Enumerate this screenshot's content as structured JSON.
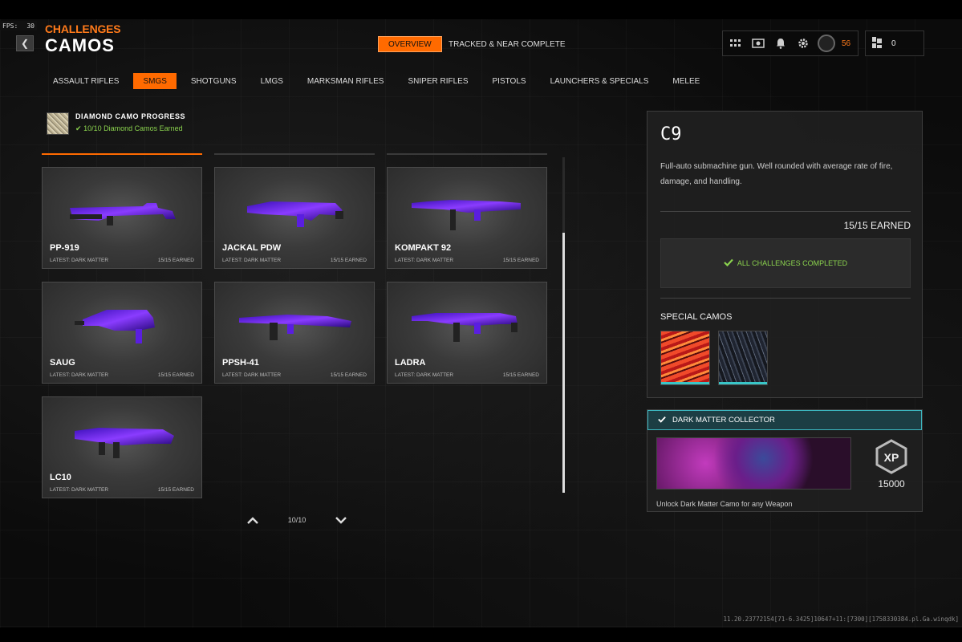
{
  "hud": {
    "fps_label": "FPS:",
    "fps_value": "30",
    "level": "56",
    "currency": "0"
  },
  "header": {
    "breadcrumb": "CHALLENGES",
    "title": "CAMOS",
    "tab_overview": "OVERVIEW",
    "tab_tracked": "TRACKED & NEAR COMPLETE"
  },
  "categories": [
    "ASSAULT RIFLES",
    "SMGS",
    "SHOTGUNS",
    "LMGS",
    "MARKSMAN RIFLES",
    "SNIPER RIFLES",
    "PISTOLS",
    "LAUNCHERS & SPECIALS",
    "MELEE"
  ],
  "active_category": "SMGS",
  "progress": {
    "title": "DIAMOND CAMO PROGRESS",
    "status": "10/10 Diamond Camos Earned"
  },
  "weapons": [
    {
      "name": "PP-919",
      "latest": "LATEST: DARK MATTER",
      "earned": "15/15 EARNED"
    },
    {
      "name": "JACKAL PDW",
      "latest": "LATEST: DARK MATTER",
      "earned": "15/15 EARNED"
    },
    {
      "name": "KOMPAKT 92",
      "latest": "LATEST: DARK MATTER",
      "earned": "15/15 EARNED"
    },
    {
      "name": "SAUG",
      "latest": "LATEST: DARK MATTER",
      "earned": "15/15 EARNED"
    },
    {
      "name": "PPSH-41",
      "latest": "LATEST: DARK MATTER",
      "earned": "15/15 EARNED"
    },
    {
      "name": "LADRA",
      "latest": "LATEST: DARK MATTER",
      "earned": "15/15 EARNED"
    },
    {
      "name": "LC10",
      "latest": "LATEST: DARK MATTER",
      "earned": "15/15 EARNED"
    }
  ],
  "pager": {
    "label": "10/10"
  },
  "detail": {
    "name": "C9",
    "description": "Full-auto submachine gun.  Well rounded with average rate of fire, damage, and handling.",
    "earned": "15/15 EARNED",
    "completed": "ALL CHALLENGES COMPLETED",
    "special_title": "SPECIAL CAMOS"
  },
  "reward": {
    "title": "DARK MATTER COLLECTOR",
    "xp_badge": "XP",
    "xp_value": "15000",
    "description": "Unlock Dark Matter Camo for any Weapon"
  },
  "version": "11.20.23772154[71-6.3425]10647+11:[7300][1758330384.pl.Ga.winqdk]",
  "colors": {
    "accent": "#ff6a00",
    "success": "#8bd34e",
    "teal": "#3cb7c0",
    "camo_purple": "#6a2cff"
  }
}
